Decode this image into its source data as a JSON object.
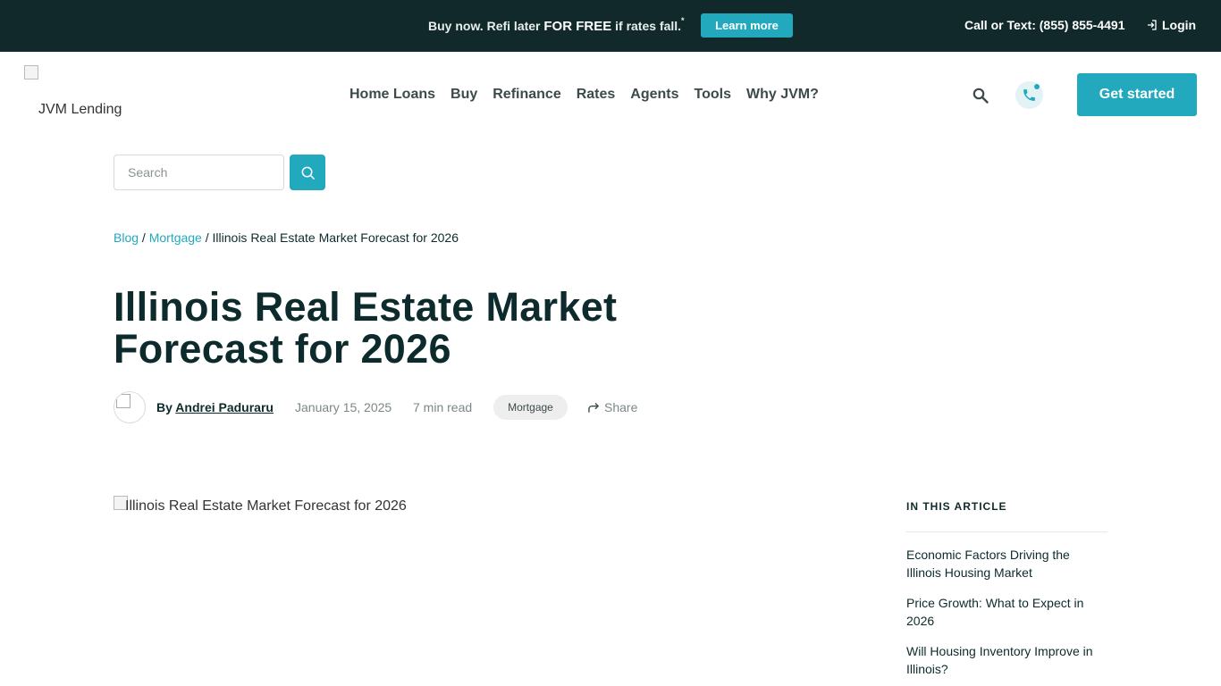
{
  "promo": {
    "text_before": "Buy now. Refi later ",
    "text_strong": "FOR FREE",
    "text_after": " if rates fall.",
    "asterisk": "*",
    "learn_more": "Learn more",
    "call": "Call or Text: (855) 855-4491",
    "login": "Login"
  },
  "header": {
    "logo_alt": "JVM Lending",
    "nav": [
      "Home Loans",
      "Buy",
      "Refinance",
      "Rates",
      "Agents",
      "Tools",
      "Why JVM?"
    ],
    "get_started": "Get started"
  },
  "blog_search": {
    "placeholder": "Search"
  },
  "breadcrumb": {
    "blog": "Blog",
    "sep1": " / ",
    "mortgage": "Mortgage",
    "sep2": " / ",
    "current": "Illinois Real Estate Market Forecast for 2026"
  },
  "article": {
    "title": "Illinois Real Estate Market Forecast for 2026",
    "by": "By ",
    "author": "Andrei Paduraru",
    "date": "January 15, 2025",
    "read_time": "7 min read",
    "tag": "Mortgage",
    "share": "Share",
    "hero_alt": "Illinois Real Estate Market Forecast for 2026"
  },
  "toc": {
    "title": "IN THIS ARTICLE",
    "items": [
      "Economic Factors Driving the Illinois Housing Market",
      "Price Growth: What to Expect in 2026",
      "Will Housing Inventory Improve in Illinois?"
    ]
  },
  "colors": {
    "promo_bg": "#11292a",
    "accent": "#23a9bd",
    "text": "#0d2b2c"
  }
}
